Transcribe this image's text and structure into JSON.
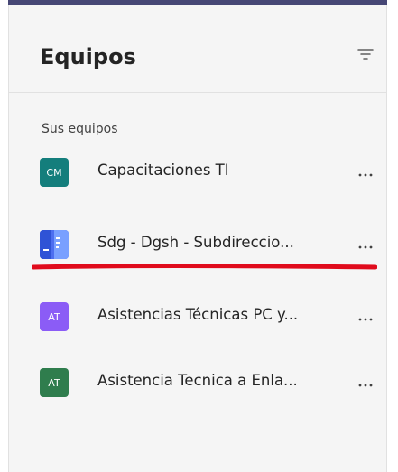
{
  "window": {
    "accent_color": "#464775"
  },
  "header": {
    "title": "Equipos",
    "filter_icon": "filter-icon"
  },
  "section": {
    "label": "Sus equipos"
  },
  "teams": [
    {
      "initials": "CM",
      "name": "Capacitaciones TI",
      "avatar_color": "#147e7c",
      "more_icon": "ellipsis-icon"
    },
    {
      "initials": "",
      "name": "Sdg - Dgsh - Subdireccio...",
      "avatar_color": "#4c72e8",
      "more_icon": "ellipsis-icon"
    },
    {
      "initials": "AT",
      "name": "Asistencias Técnicas PC y...",
      "avatar_color": "#8b5cf6",
      "more_icon": "ellipsis-icon"
    },
    {
      "initials": "AT",
      "name": "Asistencia Tecnica a Enla...",
      "avatar_color": "#2f7d4d",
      "more_icon": "ellipsis-icon"
    }
  ],
  "annotation": {
    "color": "#e00b1c"
  }
}
